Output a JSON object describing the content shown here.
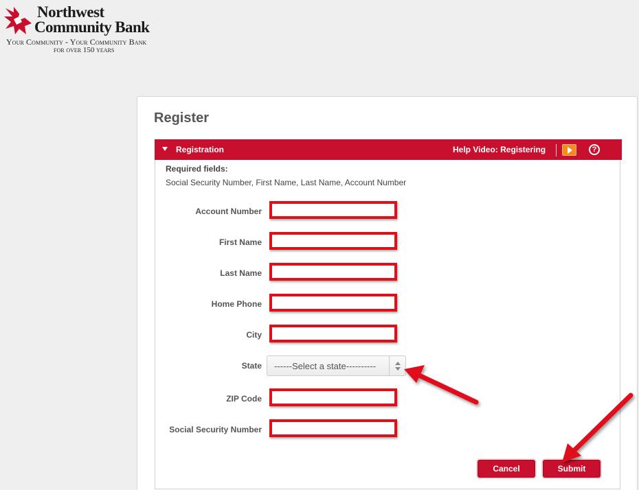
{
  "logo": {
    "name_line1": "Northwest",
    "name_line2": "Community Bank",
    "tagline_line1": "Your Community - Your Community Bank",
    "tagline_line2": "for over 150 years",
    "brand_color": "#c8102e"
  },
  "page": {
    "title": "Register"
  },
  "section": {
    "title": "Registration",
    "help_video_label": "Help Video: Registering",
    "help_icon_glyph": "?",
    "required_label": "Required fields:",
    "required_list": "Social Security Number, First Name, Last Name, Account Number"
  },
  "fields": {
    "account_number": {
      "label": "Account Number",
      "value": ""
    },
    "first_name": {
      "label": "First Name",
      "value": ""
    },
    "last_name": {
      "label": "Last Name",
      "value": ""
    },
    "home_phone": {
      "label": "Home Phone",
      "value": ""
    },
    "city": {
      "label": "City",
      "value": ""
    },
    "state": {
      "label": "State",
      "selected": "------Select a state----------"
    },
    "zip": {
      "label": "ZIP Code",
      "value": ""
    },
    "ssn": {
      "label": "Social Security Number",
      "value": ""
    }
  },
  "buttons": {
    "cancel": "Cancel",
    "submit": "Submit"
  },
  "colors": {
    "accent": "#c8102e",
    "highlight": "#e0101a",
    "video_icon": "#f48a22"
  }
}
